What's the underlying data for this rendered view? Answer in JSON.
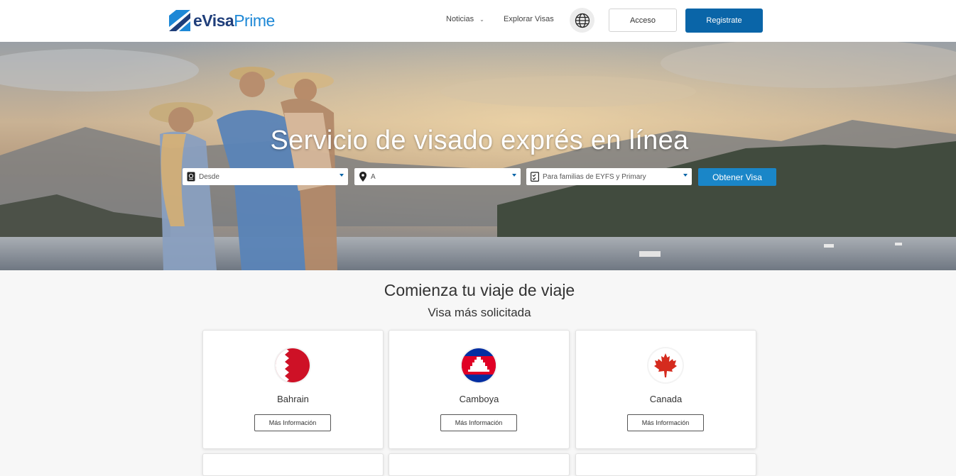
{
  "header": {
    "logo": {
      "e": "e",
      "visa": "Visa",
      "prime": "Prime"
    },
    "nav": {
      "news": "Noticias",
      "explore": "Explorar Visas"
    },
    "login": "Acceso",
    "register": "Registrate"
  },
  "hero": {
    "title": "Servicio de visado exprés en línea",
    "from_placeholder": "Desde",
    "to_placeholder": "A",
    "type_value": "Para familias de EYFS y Primary",
    "submit": "Obtener Visa"
  },
  "section": {
    "title": "Comienza tu viaje de viaje",
    "subtitle": "Visa más solicitada",
    "cards": [
      {
        "country": "Bahrain",
        "button": "Más Información"
      },
      {
        "country": "Camboya",
        "button": "Más Información"
      },
      {
        "country": "Canada",
        "button": "Más Información"
      }
    ]
  },
  "colors": {
    "primary": "#0a65a8",
    "accent": "#1a86c8",
    "logo_dark": "#1f3e7a",
    "logo_light": "#1e88d6"
  },
  "icons": [
    "logo-icon",
    "chevron-down-icon",
    "globe-icon",
    "passport-icon",
    "location-pin-icon",
    "checklist-icon",
    "bahrain-flag-icon",
    "cambodia-flag-icon",
    "canada-flag-icon"
  ]
}
